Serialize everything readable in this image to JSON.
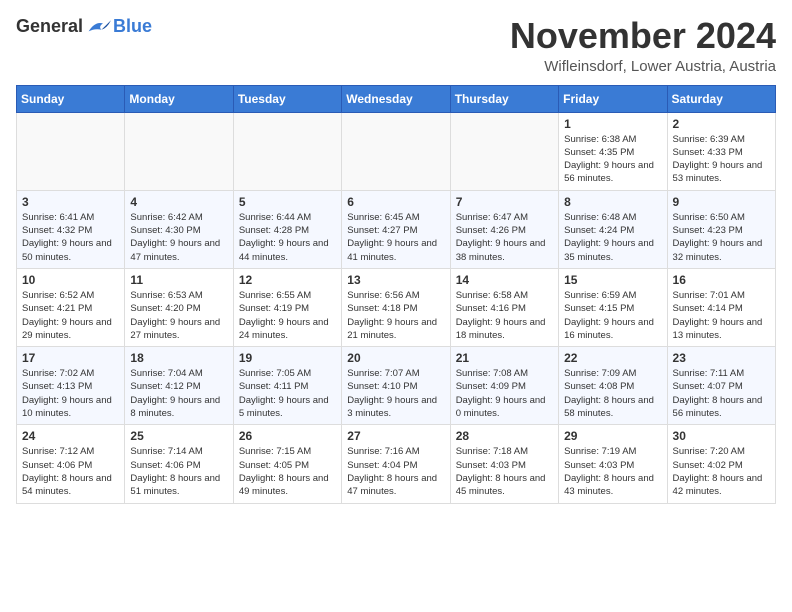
{
  "header": {
    "logo": {
      "general": "General",
      "blue": "Blue"
    },
    "title": "November 2024",
    "subtitle": "Wifleinsdorf, Lower Austria, Austria"
  },
  "weekdays": [
    "Sunday",
    "Monday",
    "Tuesday",
    "Wednesday",
    "Thursday",
    "Friday",
    "Saturday"
  ],
  "weeks": [
    [
      {
        "day": "",
        "info": ""
      },
      {
        "day": "",
        "info": ""
      },
      {
        "day": "",
        "info": ""
      },
      {
        "day": "",
        "info": ""
      },
      {
        "day": "",
        "info": ""
      },
      {
        "day": "1",
        "info": "Sunrise: 6:38 AM\nSunset: 4:35 PM\nDaylight: 9 hours and 56 minutes."
      },
      {
        "day": "2",
        "info": "Sunrise: 6:39 AM\nSunset: 4:33 PM\nDaylight: 9 hours and 53 minutes."
      }
    ],
    [
      {
        "day": "3",
        "info": "Sunrise: 6:41 AM\nSunset: 4:32 PM\nDaylight: 9 hours and 50 minutes."
      },
      {
        "day": "4",
        "info": "Sunrise: 6:42 AM\nSunset: 4:30 PM\nDaylight: 9 hours and 47 minutes."
      },
      {
        "day": "5",
        "info": "Sunrise: 6:44 AM\nSunset: 4:28 PM\nDaylight: 9 hours and 44 minutes."
      },
      {
        "day": "6",
        "info": "Sunrise: 6:45 AM\nSunset: 4:27 PM\nDaylight: 9 hours and 41 minutes."
      },
      {
        "day": "7",
        "info": "Sunrise: 6:47 AM\nSunset: 4:26 PM\nDaylight: 9 hours and 38 minutes."
      },
      {
        "day": "8",
        "info": "Sunrise: 6:48 AM\nSunset: 4:24 PM\nDaylight: 9 hours and 35 minutes."
      },
      {
        "day": "9",
        "info": "Sunrise: 6:50 AM\nSunset: 4:23 PM\nDaylight: 9 hours and 32 minutes."
      }
    ],
    [
      {
        "day": "10",
        "info": "Sunrise: 6:52 AM\nSunset: 4:21 PM\nDaylight: 9 hours and 29 minutes."
      },
      {
        "day": "11",
        "info": "Sunrise: 6:53 AM\nSunset: 4:20 PM\nDaylight: 9 hours and 27 minutes."
      },
      {
        "day": "12",
        "info": "Sunrise: 6:55 AM\nSunset: 4:19 PM\nDaylight: 9 hours and 24 minutes."
      },
      {
        "day": "13",
        "info": "Sunrise: 6:56 AM\nSunset: 4:18 PM\nDaylight: 9 hours and 21 minutes."
      },
      {
        "day": "14",
        "info": "Sunrise: 6:58 AM\nSunset: 4:16 PM\nDaylight: 9 hours and 18 minutes."
      },
      {
        "day": "15",
        "info": "Sunrise: 6:59 AM\nSunset: 4:15 PM\nDaylight: 9 hours and 16 minutes."
      },
      {
        "day": "16",
        "info": "Sunrise: 7:01 AM\nSunset: 4:14 PM\nDaylight: 9 hours and 13 minutes."
      }
    ],
    [
      {
        "day": "17",
        "info": "Sunrise: 7:02 AM\nSunset: 4:13 PM\nDaylight: 9 hours and 10 minutes."
      },
      {
        "day": "18",
        "info": "Sunrise: 7:04 AM\nSunset: 4:12 PM\nDaylight: 9 hours and 8 minutes."
      },
      {
        "day": "19",
        "info": "Sunrise: 7:05 AM\nSunset: 4:11 PM\nDaylight: 9 hours and 5 minutes."
      },
      {
        "day": "20",
        "info": "Sunrise: 7:07 AM\nSunset: 4:10 PM\nDaylight: 9 hours and 3 minutes."
      },
      {
        "day": "21",
        "info": "Sunrise: 7:08 AM\nSunset: 4:09 PM\nDaylight: 9 hours and 0 minutes."
      },
      {
        "day": "22",
        "info": "Sunrise: 7:09 AM\nSunset: 4:08 PM\nDaylight: 8 hours and 58 minutes."
      },
      {
        "day": "23",
        "info": "Sunrise: 7:11 AM\nSunset: 4:07 PM\nDaylight: 8 hours and 56 minutes."
      }
    ],
    [
      {
        "day": "24",
        "info": "Sunrise: 7:12 AM\nSunset: 4:06 PM\nDaylight: 8 hours and 54 minutes."
      },
      {
        "day": "25",
        "info": "Sunrise: 7:14 AM\nSunset: 4:06 PM\nDaylight: 8 hours and 51 minutes."
      },
      {
        "day": "26",
        "info": "Sunrise: 7:15 AM\nSunset: 4:05 PM\nDaylight: 8 hours and 49 minutes."
      },
      {
        "day": "27",
        "info": "Sunrise: 7:16 AM\nSunset: 4:04 PM\nDaylight: 8 hours and 47 minutes."
      },
      {
        "day": "28",
        "info": "Sunrise: 7:18 AM\nSunset: 4:03 PM\nDaylight: 8 hours and 45 minutes."
      },
      {
        "day": "29",
        "info": "Sunrise: 7:19 AM\nSunset: 4:03 PM\nDaylight: 8 hours and 43 minutes."
      },
      {
        "day": "30",
        "info": "Sunrise: 7:20 AM\nSunset: 4:02 PM\nDaylight: 8 hours and 42 minutes."
      }
    ]
  ]
}
